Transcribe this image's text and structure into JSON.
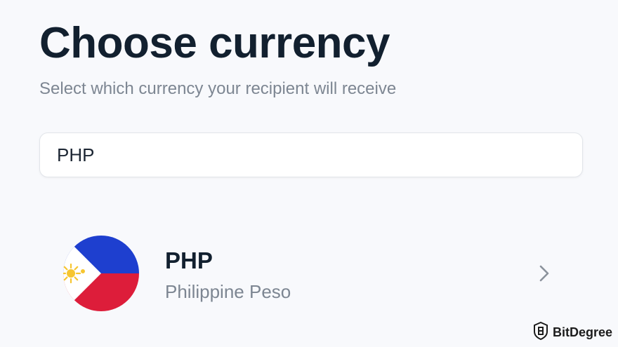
{
  "header": {
    "title": "Choose currency",
    "subtitle": "Select which currency your recipient will receive"
  },
  "search": {
    "value": "PHP"
  },
  "results": [
    {
      "code": "PHP",
      "name": "Philippine Peso",
      "flag_icon": "philippines-flag-icon"
    }
  ],
  "watermark": {
    "text": "BitDegree"
  },
  "colors": {
    "title": "#12202f",
    "muted_text": "#7d8692",
    "background": "#f8f9fc",
    "flag_blue": "#1e3fcf",
    "flag_red": "#dd1d3a",
    "flag_white": "#ffffff",
    "flag_yellow": "#f6c530"
  }
}
